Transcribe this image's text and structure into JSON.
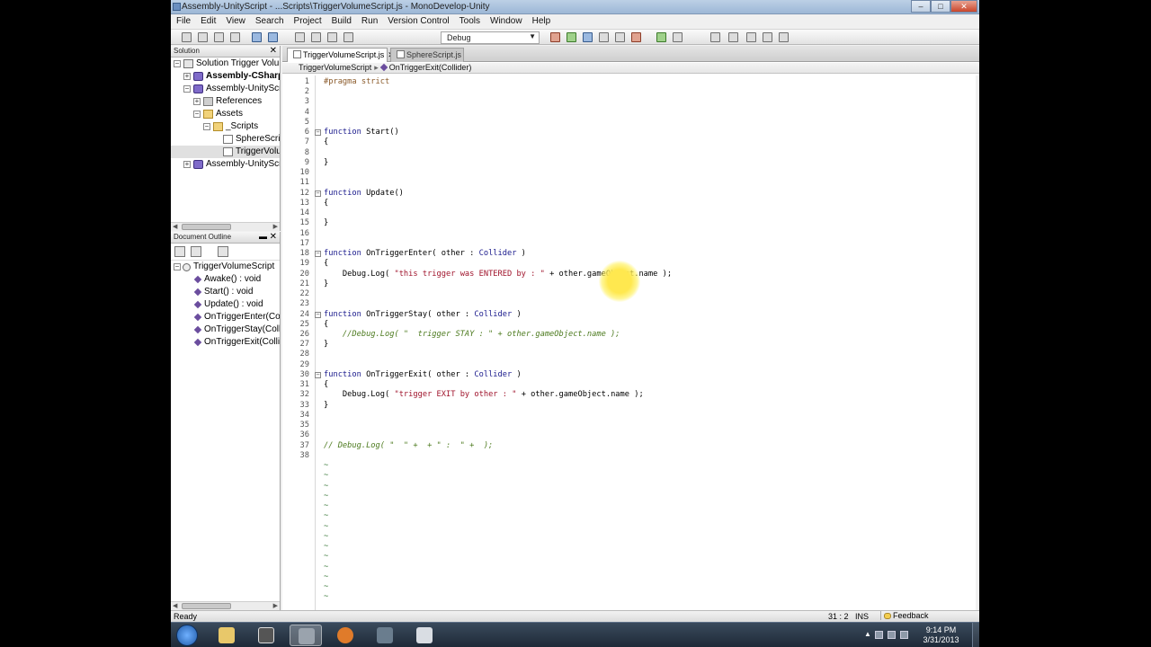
{
  "window": {
    "title": "Assembly-UnityScript - ...Scripts\\TriggerVolumeScript.js - MonoDevelop-Unity",
    "buttons": [
      "–",
      "□",
      "✕"
    ]
  },
  "menu": [
    "File",
    "Edit",
    "View",
    "Search",
    "Project",
    "Build",
    "Run",
    "Version Control",
    "Tools",
    "Window",
    "Help"
  ],
  "toolbar": {
    "configuration": "Debug"
  },
  "solution_pad": {
    "title": "Solution",
    "items": [
      {
        "label": "Solution Trigger Volume",
        "icon": "solution-icon",
        "expander": "−",
        "depth": 0
      },
      {
        "label": "Assembly-CSharp-E",
        "icon": "project-icon",
        "expander": "+",
        "depth": 1,
        "bold": true
      },
      {
        "label": "Assembly-UnityScript",
        "icon": "project-icon",
        "expander": "−",
        "depth": 1
      },
      {
        "label": "References",
        "icon": "references-icon",
        "expander": "+",
        "depth": 2
      },
      {
        "label": "Assets",
        "icon": "folder-icon",
        "expander": "−",
        "depth": 2
      },
      {
        "label": "_Scripts",
        "icon": "folder-icon",
        "expander": "−",
        "depth": 3
      },
      {
        "label": "SphereScript",
        "icon": "file-icon",
        "expander": "",
        "depth": 4
      },
      {
        "label": "TriggerVolume",
        "icon": "file-icon",
        "expander": "",
        "depth": 4,
        "selected": true
      },
      {
        "label": "Assembly-UnityScript",
        "icon": "project-icon",
        "expander": "+",
        "depth": 1
      }
    ]
  },
  "outline_pad": {
    "title": "Document Outline",
    "root": "TriggerVolumeScript",
    "members": [
      "Awake() : void",
      "Start() : void",
      "Update() : void",
      "OnTriggerEnter(Collide",
      "OnTriggerStay(Collider",
      "OnTriggerExit(Collider)"
    ]
  },
  "tabs": [
    {
      "label": "TriggerVolumeScript.js",
      "active": true
    },
    {
      "label": "SphereScript.js",
      "active": false
    }
  ],
  "breadcrumb": {
    "file": "TriggerVolumeScript",
    "member": "OnTriggerExit(Collider)"
  },
  "code_lines": [
    {
      "n": "1",
      "segs": [
        [
          "pre",
          "#pragma strict"
        ]
      ]
    },
    {
      "n": "2",
      "segs": []
    },
    {
      "n": "3",
      "segs": []
    },
    {
      "n": "4",
      "segs": []
    },
    {
      "n": "5",
      "segs": []
    },
    {
      "n": "6",
      "segs": [
        [
          "kw",
          "function"
        ],
        [
          "",
          " Start()"
        ]
      ],
      "fold": "−"
    },
    {
      "n": "7",
      "segs": [
        [
          "",
          "{"
        ]
      ]
    },
    {
      "n": "8",
      "segs": []
    },
    {
      "n": "9",
      "segs": [
        [
          "",
          "}"
        ]
      ]
    },
    {
      "n": "10",
      "segs": []
    },
    {
      "n": "11",
      "segs": []
    },
    {
      "n": "12",
      "segs": [
        [
          "kw",
          "function"
        ],
        [
          "",
          " Update()"
        ]
      ],
      "fold": "−"
    },
    {
      "n": "13",
      "segs": [
        [
          "",
          "{"
        ]
      ]
    },
    {
      "n": "14",
      "segs": []
    },
    {
      "n": "15",
      "segs": [
        [
          "",
          "}"
        ]
      ]
    },
    {
      "n": "16",
      "segs": []
    },
    {
      "n": "17",
      "segs": []
    },
    {
      "n": "18",
      "segs": [
        [
          "kw",
          "function"
        ],
        [
          "",
          " OnTriggerEnter( other : "
        ],
        [
          "kw",
          "Collider"
        ],
        [
          "",
          " )"
        ]
      ],
      "fold": "−"
    },
    {
      "n": "19",
      "segs": [
        [
          "",
          "{"
        ]
      ]
    },
    {
      "n": "20",
      "segs": [
        [
          "",
          "    Debug.Log( "
        ],
        [
          "str",
          "\"this trigger was ENTERED by : \""
        ],
        [
          "",
          " + other.gameObject.name );"
        ]
      ]
    },
    {
      "n": "21",
      "segs": [
        [
          "",
          "}"
        ]
      ]
    },
    {
      "n": "22",
      "segs": []
    },
    {
      "n": "23",
      "segs": []
    },
    {
      "n": "24",
      "segs": [
        [
          "kw",
          "function"
        ],
        [
          "",
          " OnTriggerStay( other : "
        ],
        [
          "kw",
          "Collider"
        ],
        [
          "",
          " )"
        ]
      ],
      "fold": "−"
    },
    {
      "n": "25",
      "segs": [
        [
          "",
          "{"
        ]
      ]
    },
    {
      "n": "26",
      "segs": [
        [
          "cmt",
          "    //Debug.Log( \"  trigger STAY : \" + other.gameObject.name );"
        ]
      ]
    },
    {
      "n": "27",
      "segs": [
        [
          "",
          "}"
        ]
      ]
    },
    {
      "n": "28",
      "segs": []
    },
    {
      "n": "29",
      "segs": []
    },
    {
      "n": "30",
      "segs": [
        [
          "kw",
          "function"
        ],
        [
          "",
          " OnTriggerExit( other : "
        ],
        [
          "kw",
          "Collider"
        ],
        [
          "",
          " )"
        ]
      ],
      "fold": "−"
    },
    {
      "n": "31",
      "segs": [
        [
          "",
          "{"
        ]
      ]
    },
    {
      "n": "32",
      "segs": [
        [
          "",
          "    Debug.Log( "
        ],
        [
          "str",
          "\"trigger EXIT by other : \""
        ],
        [
          "",
          " + other.gameObject.name );"
        ]
      ]
    },
    {
      "n": "33",
      "segs": [
        [
          "",
          "}"
        ]
      ]
    },
    {
      "n": "34",
      "segs": []
    },
    {
      "n": "35",
      "segs": []
    },
    {
      "n": "36",
      "segs": []
    },
    {
      "n": "37",
      "segs": [
        [
          "cmt",
          "// Debug.Log( \"  \" +  + \" :  \" +  );"
        ]
      ]
    },
    {
      "n": "38",
      "segs": []
    },
    {
      "n": "",
      "segs": [
        [
          "tilde",
          "~"
        ]
      ]
    },
    {
      "n": "",
      "segs": [
        [
          "tilde",
          "~"
        ]
      ]
    },
    {
      "n": "",
      "segs": [
        [
          "tilde",
          "~"
        ]
      ]
    },
    {
      "n": "",
      "segs": [
        [
          "tilde",
          "~"
        ]
      ]
    },
    {
      "n": "",
      "segs": [
        [
          "tilde",
          "~"
        ]
      ]
    },
    {
      "n": "",
      "segs": [
        [
          "tilde",
          "~"
        ]
      ]
    },
    {
      "n": "",
      "segs": [
        [
          "tilde",
          "~"
        ]
      ]
    },
    {
      "n": "",
      "segs": [
        [
          "tilde",
          "~"
        ]
      ]
    },
    {
      "n": "",
      "segs": [
        [
          "tilde",
          "~"
        ]
      ]
    },
    {
      "n": "",
      "segs": [
        [
          "tilde",
          "~"
        ]
      ]
    },
    {
      "n": "",
      "segs": [
        [
          "tilde",
          "~"
        ]
      ]
    },
    {
      "n": "",
      "segs": [
        [
          "tilde",
          "~"
        ]
      ]
    },
    {
      "n": "",
      "segs": [
        [
          "tilde",
          "~"
        ]
      ]
    },
    {
      "n": "",
      "segs": [
        [
          "tilde",
          "~"
        ]
      ]
    }
  ],
  "status": {
    "text": "Ready",
    "position": "31 : 2",
    "mode": "INS",
    "feedback": "Feedback"
  },
  "taskbar": {
    "apps": [
      "explorer-icon",
      "unity-icon",
      "monodevelop-icon",
      "firefox-icon",
      "photoshop-icon",
      "notepad-icon"
    ],
    "active_index": 2,
    "time": "9:14 PM",
    "date": "3/31/2013"
  },
  "colors": {
    "keyword": "#1a1a8c",
    "string": "#a0142c",
    "comment": "#4c7a1e",
    "titlebar": "#9db7d6"
  }
}
